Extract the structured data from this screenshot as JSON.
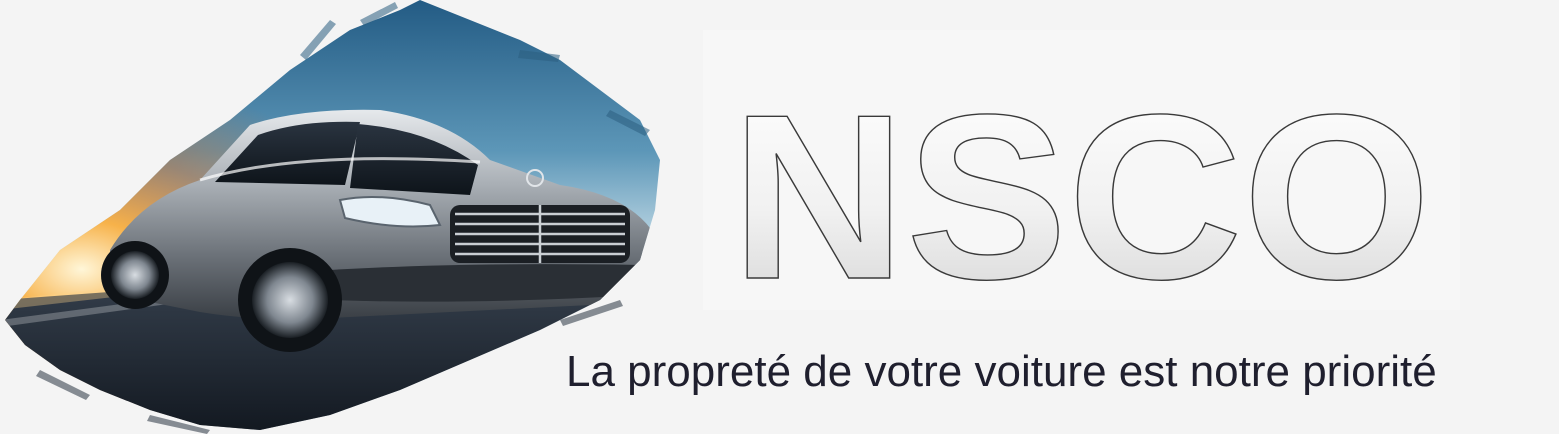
{
  "brand": {
    "logo_text": "NSCO",
    "tagline": "La propreté de votre voiture est notre priorité"
  },
  "hero": {
    "image": "silver-luxury-sedan-paint-stroke",
    "icon": "car-icon"
  },
  "colors": {
    "background": "#f4f4f4",
    "tagline": "#1f1f2e",
    "logo_fill_top": "#ffffff",
    "logo_fill_bottom": "#d9d9d9",
    "logo_outline": "#3a3a3a",
    "sky_top": "#2f6f98",
    "sky_light": "#cfe5ef",
    "sun_glow": "#f5a33a",
    "car_silver": "#9ea4aa"
  }
}
